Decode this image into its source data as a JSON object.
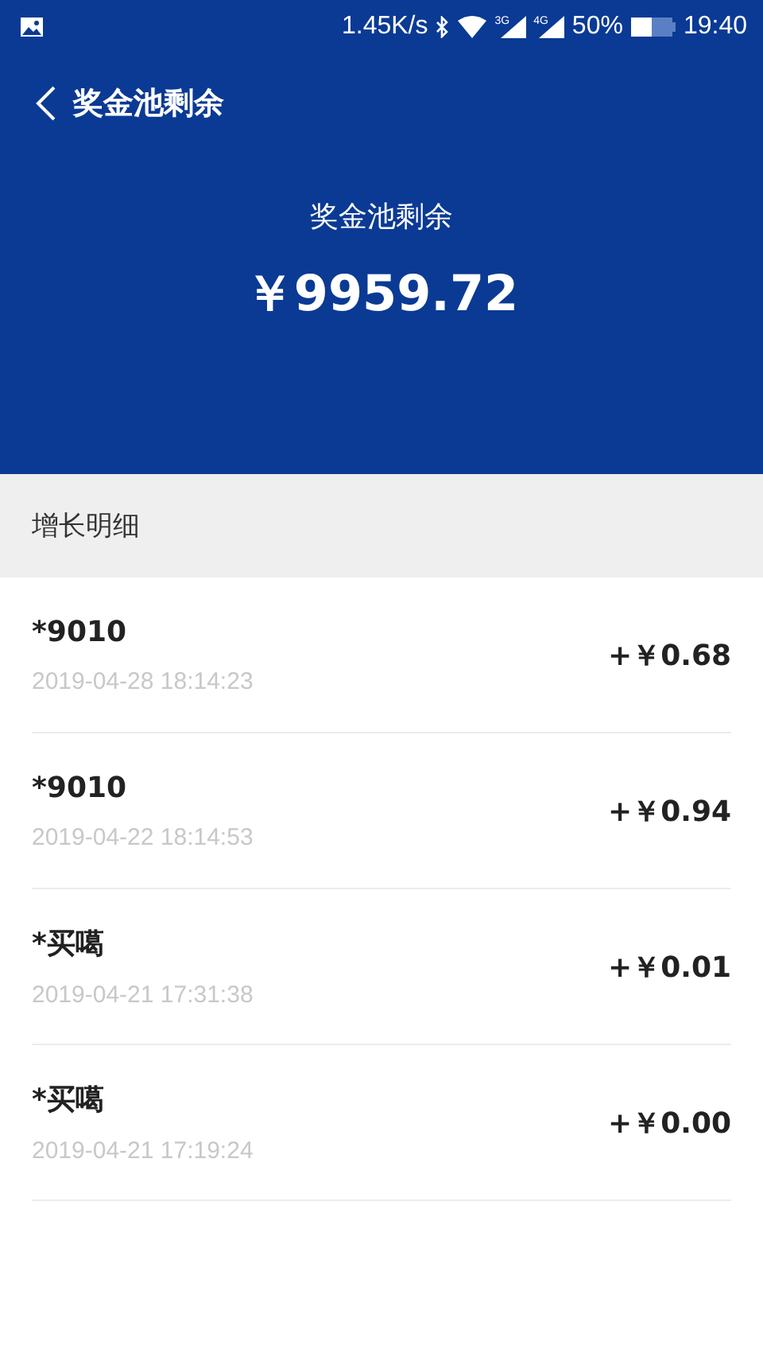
{
  "status_bar": {
    "speed": "1.45K/s",
    "network_1": "3G",
    "network_2": "4G",
    "battery": "50%",
    "time": "19:40"
  },
  "nav": {
    "title": "奖金池剩余"
  },
  "summary": {
    "label": "奖金池剩余",
    "amount": "￥9959.72"
  },
  "section": {
    "title": "增长明细"
  },
  "records": [
    {
      "name": "*9010",
      "time": "2019-04-28 18:14:23",
      "amount": "+￥0.68"
    },
    {
      "name": "*9010",
      "time": "2019-04-22 18:14:53",
      "amount": "+￥0.94"
    },
    {
      "name": "*买噶",
      "time": "2019-04-21 17:31:38",
      "amount": "+￥0.01"
    },
    {
      "name": "*买噶",
      "time": "2019-04-21 17:19:24",
      "amount": "+￥0.00"
    }
  ]
}
